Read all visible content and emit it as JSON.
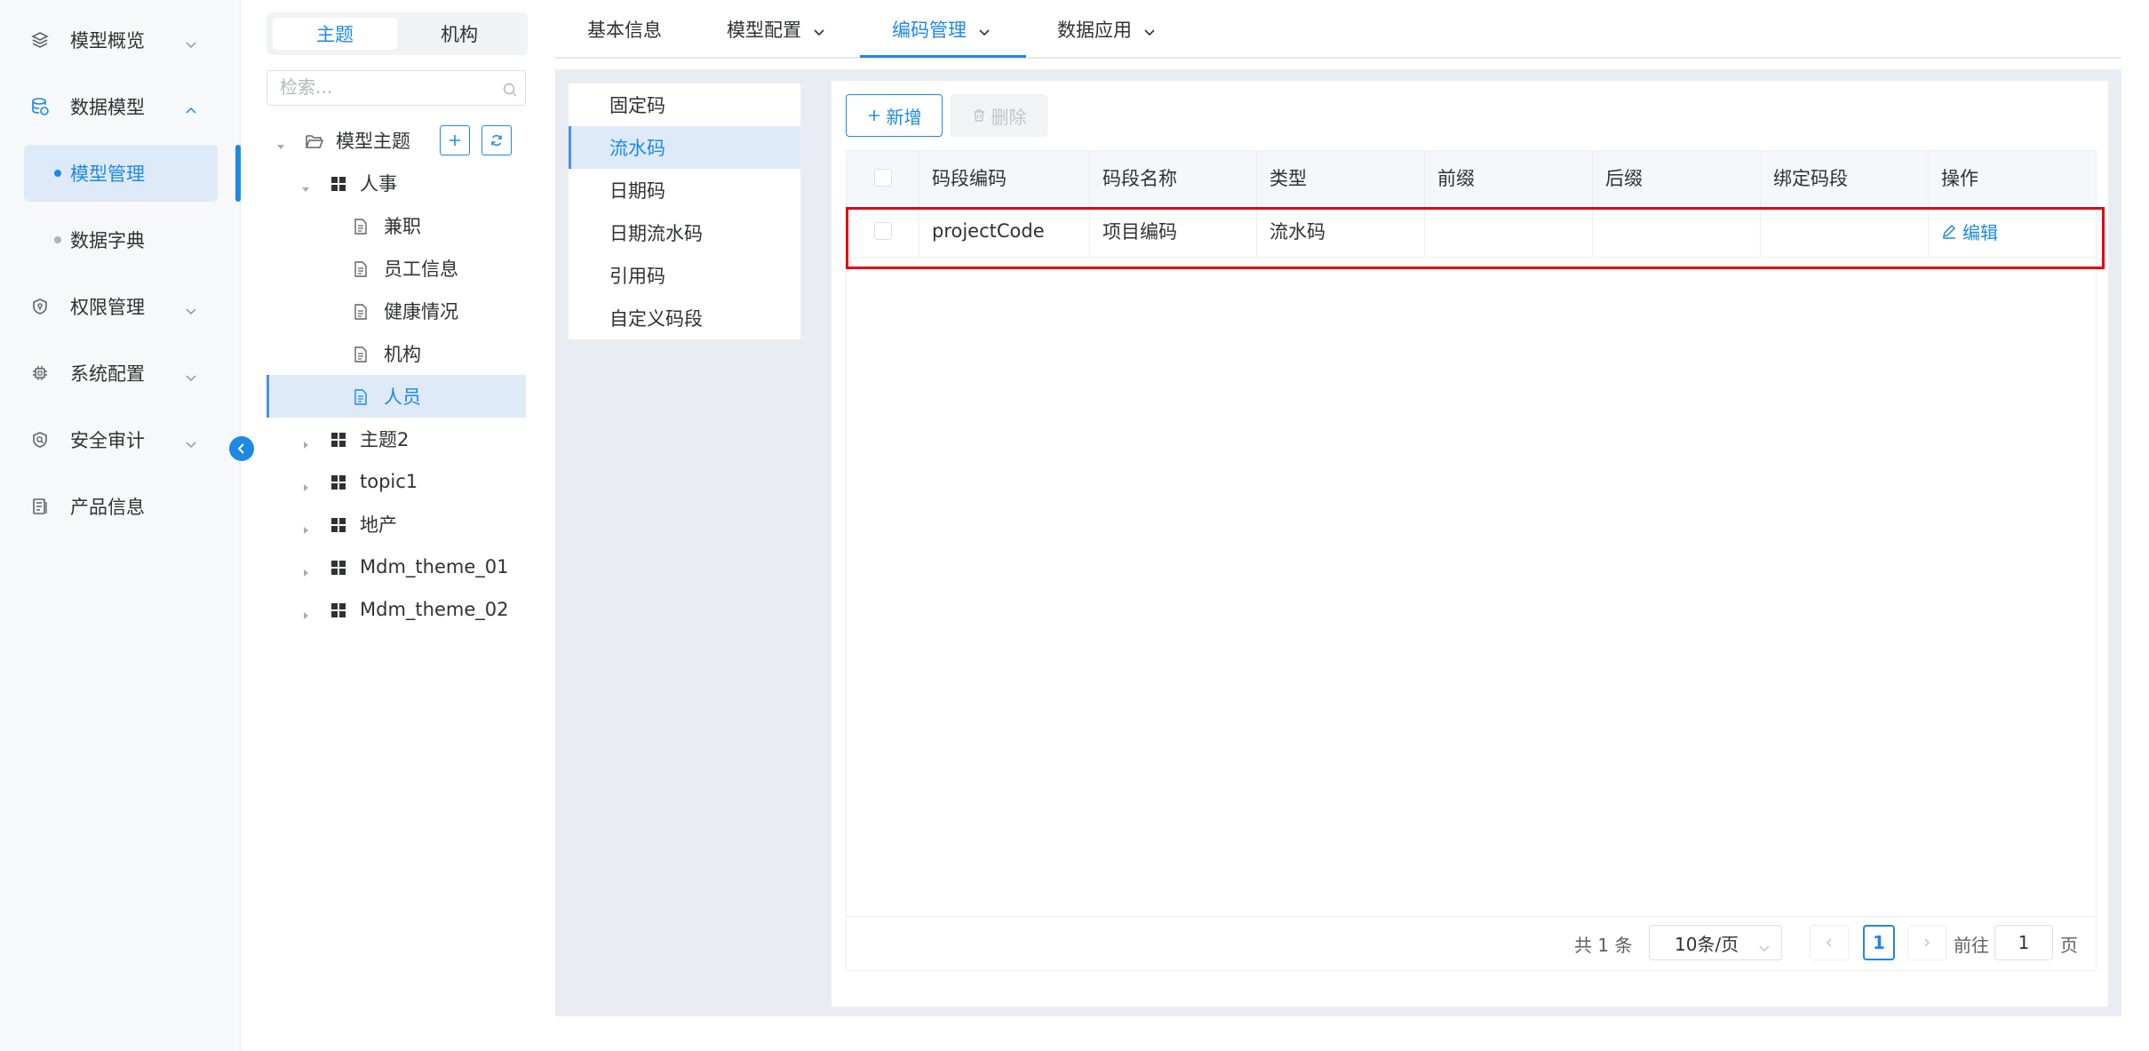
{
  "sidebar": {
    "items": [
      {
        "label": "模型概览",
        "icon": "layers-icon"
      },
      {
        "label": "数据模型",
        "icon": "database-icon"
      },
      {
        "label": "权限管理",
        "icon": "shield-icon"
      },
      {
        "label": "系统配置",
        "icon": "chip-icon"
      },
      {
        "label": "安全审计",
        "icon": "audit-shield-icon"
      },
      {
        "label": "产品信息",
        "icon": "document-list-icon"
      }
    ],
    "sub_items": [
      {
        "label": "模型管理"
      },
      {
        "label": "数据字典"
      }
    ]
  },
  "tree_panel": {
    "segments": [
      "主题",
      "机构"
    ],
    "search_placeholder": "检索...",
    "root_label": "模型主题",
    "nodes": [
      {
        "label": "人事"
      },
      {
        "label": "兼职"
      },
      {
        "label": "员工信息"
      },
      {
        "label": "健康情况"
      },
      {
        "label": "机构"
      },
      {
        "label": "人员"
      },
      {
        "label": "主题2"
      },
      {
        "label": "topic1"
      },
      {
        "label": "地产"
      },
      {
        "label": "Mdm_theme_01"
      },
      {
        "label": "Mdm_theme_02"
      }
    ]
  },
  "tabs": [
    {
      "label": "基本信息"
    },
    {
      "label": "模型配置"
    },
    {
      "label": "编码管理"
    },
    {
      "label": "数据应用"
    }
  ],
  "code_types": [
    "固定码",
    "流水码",
    "日期码",
    "日期流水码",
    "引用码",
    "自定义码段"
  ],
  "toolbar": {
    "add_label": "新增",
    "delete_label": "删除"
  },
  "table": {
    "headers": [
      "码段编码",
      "码段名称",
      "类型",
      "前缀",
      "后缀",
      "绑定码段",
      "操作"
    ],
    "rows": [
      {
        "code": "projectCode",
        "name": "项目编码",
        "type": "流水码",
        "prefix": "",
        "suffix": "",
        "bound": "",
        "action": "编辑"
      }
    ]
  },
  "pagination": {
    "total_text": "共 1 条",
    "page_size": "10条/页",
    "current_page": "1",
    "goto_label": "前往",
    "goto_value": "1",
    "page_suffix": "页"
  },
  "colors": {
    "accent": "#1e88e5",
    "highlight": "#e60012"
  }
}
